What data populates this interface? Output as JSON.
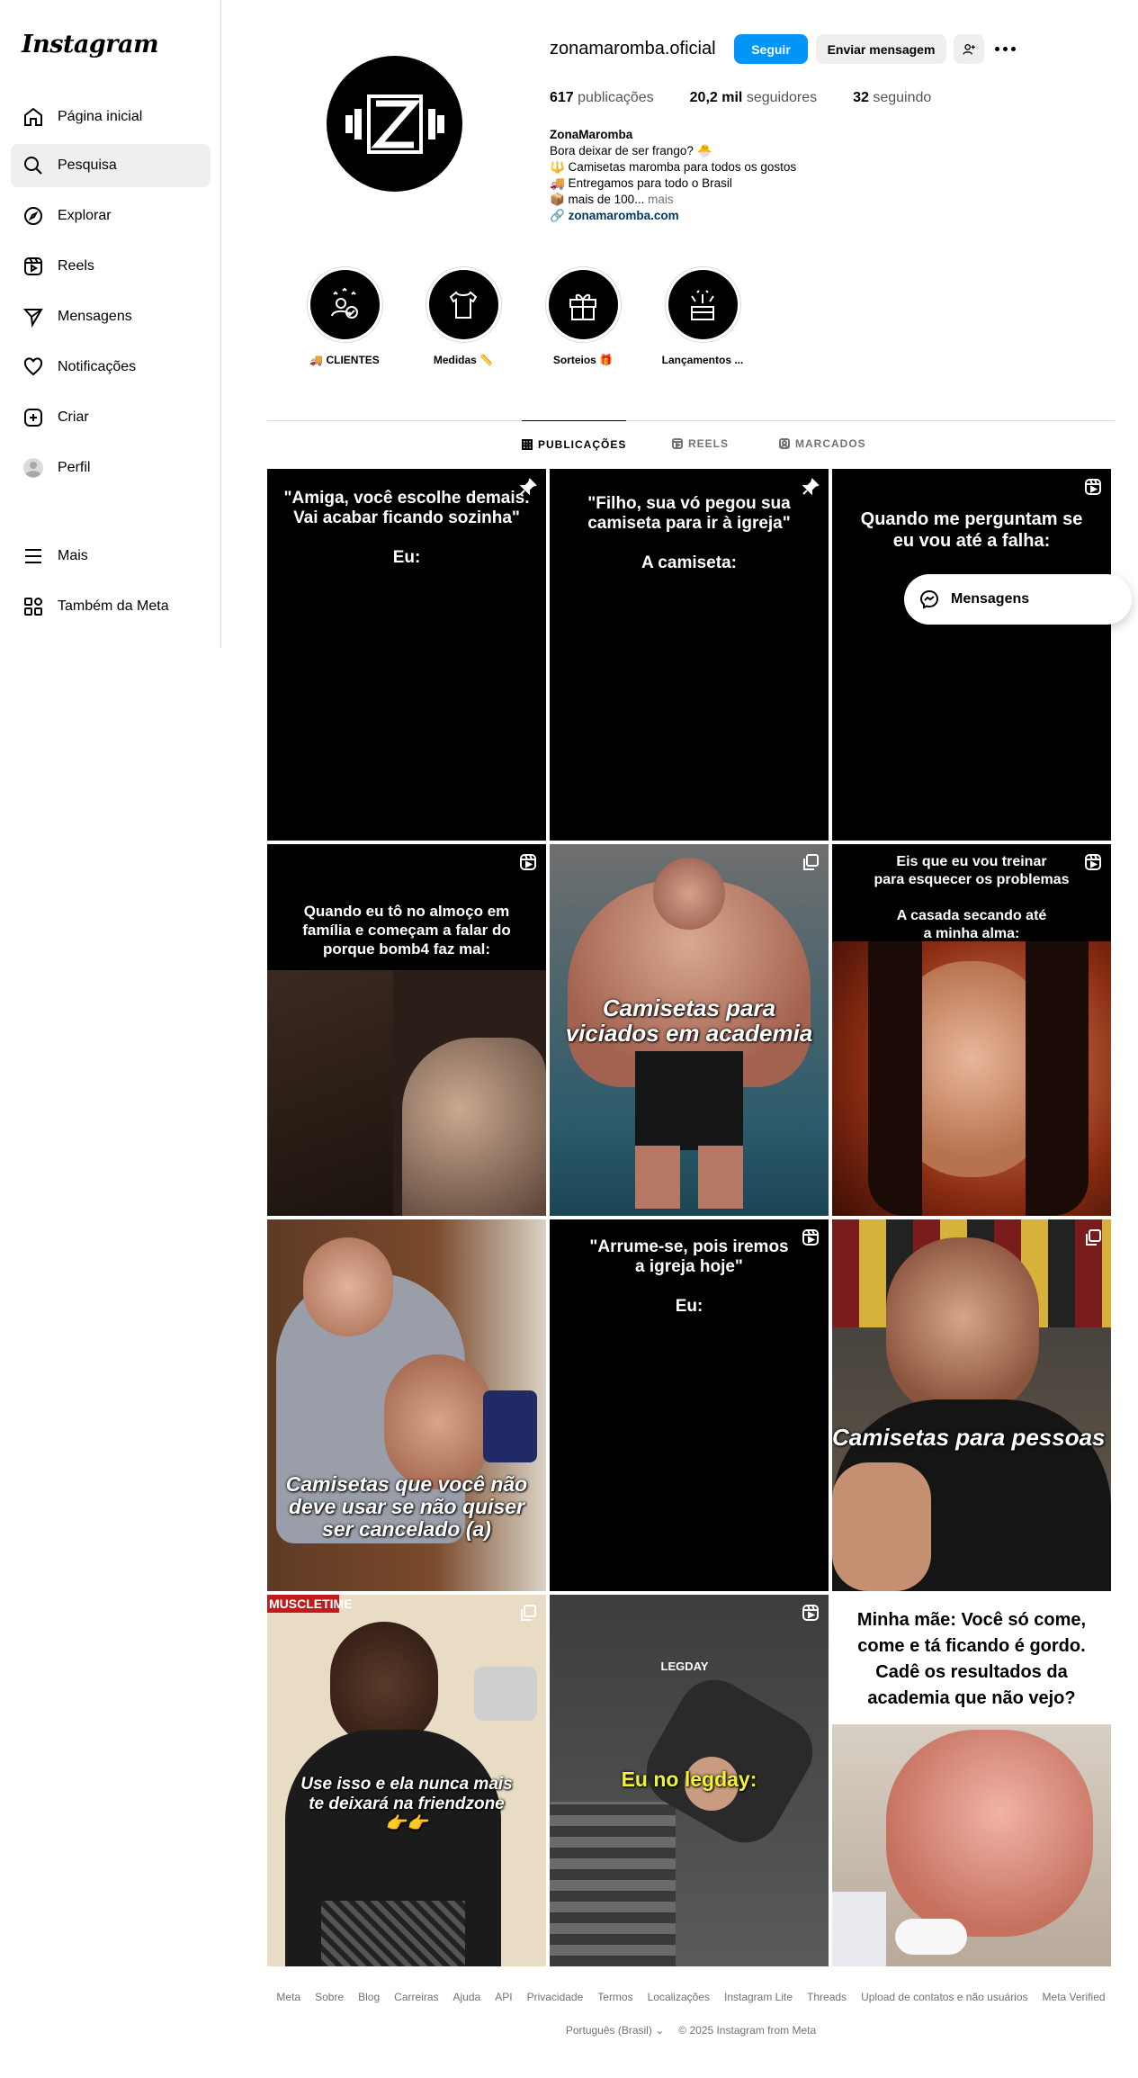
{
  "sidebar": {
    "logo": "Instagram",
    "items": [
      {
        "label": "Página inicial",
        "icon": "home-icon"
      },
      {
        "label": "Pesquisa",
        "icon": "search-icon"
      },
      {
        "label": "Explorar",
        "icon": "compass-icon"
      },
      {
        "label": "Reels",
        "icon": "reels-icon"
      },
      {
        "label": "Mensagens",
        "icon": "send-icon"
      },
      {
        "label": "Notificações",
        "icon": "heart-icon"
      },
      {
        "label": "Criar",
        "icon": "plus-icon"
      },
      {
        "label": "Perfil",
        "icon": "avatar-icon"
      }
    ],
    "bottom": [
      {
        "label": "Mais",
        "icon": "menu-icon"
      },
      {
        "label": "Também da Meta",
        "icon": "meta-apps-icon"
      }
    ]
  },
  "profile": {
    "username": "zonamaromba.oficial",
    "follow_label": "Seguir",
    "message_label": "Enviar mensagem",
    "stats": {
      "posts_count": "617",
      "posts_label": "publicações",
      "followers_count": "20,2 mil",
      "followers_label": "seguidores",
      "following_count": "32",
      "following_label": "seguindo"
    },
    "bio": {
      "name": "ZonaMaromba",
      "line1": "Bora deixar de ser frango? 🐣",
      "line2": "🔱 Camisetas maromba para todos os gostos",
      "line3": "🚚 Entregamos para todo o Brasil",
      "line4": "📦 mais de 100...",
      "more": "mais",
      "link": "zonamaromba.com"
    }
  },
  "highlights": [
    {
      "label": "🚚 CLIENTES"
    },
    {
      "label": "Medidas 📏"
    },
    {
      "label": "Sorteios 🎁"
    },
    {
      "label": "Lançamentos ..."
    }
  ],
  "tabs": {
    "posts": "PUBLICAÇÕES",
    "reels": "REELS",
    "tagged": "MARCADOS"
  },
  "posts": [
    {
      "caption": "\"Amiga, você escolhe demais.\nVai acabar ficando sozinha\"\n\nEu:",
      "badge": "pin-icon"
    },
    {
      "caption": "\"Filho, sua vó pegou sua\ncamiseta para ir à igreja\"\n\nA camiseta:",
      "badge": "pin-icon"
    },
    {
      "caption": "Quando me perguntam se\neu vou até a falha:",
      "badge": "reel-icon"
    },
    {
      "caption": "Quando eu tô no almoço em\nfamília e começam a falar do\nporque bomb4 faz mal:",
      "badge": "reel-icon"
    },
    {
      "overlay": "Camisetas para\nviciados em academia",
      "badge": "carousel-icon"
    },
    {
      "caption": "Eis que eu vou treinar\npara esquecer os problemas\n\nA casada secando até\na minha alma:",
      "badge": "reel-icon"
    },
    {
      "overlay": "Camisetas que você não\ndeve usar se não quiser\nser cancelado (a)",
      "badge": "none"
    },
    {
      "caption": "\"Arrume-se, pois iremos\na igreja hoje\"\n\nEu:",
      "badge": "reel-icon"
    },
    {
      "overlay": "Camisetas para pessoas\nextrovertidas",
      "badge": "carousel-icon"
    },
    {
      "overlay": "Use isso e ela nunca mais\nte deixará na friendzone\n👉👉",
      "badge": "carousel-icon",
      "tag": "MUSCLETIME"
    },
    {
      "overlay": "Eu no legday:",
      "badge": "reel-icon",
      "tag": "LEGDAY"
    },
    {
      "caption": "Minha mãe: Você só come,\ncome e tá ficando é gordo.\nCadê os resultados da\nacademia que não vejo?",
      "badge": "none"
    }
  ],
  "messages_pill": "Mensagens",
  "footer": {
    "links": [
      "Meta",
      "Sobre",
      "Blog",
      "Carreiras",
      "Ajuda",
      "API",
      "Privacidade",
      "Termos",
      "Localizações",
      "Instagram Lite",
      "Threads",
      "Upload de contatos e não usuários",
      "Meta Verified"
    ],
    "language": "Português (Brasil)",
    "copyright": "© 2025 Instagram from Meta"
  }
}
